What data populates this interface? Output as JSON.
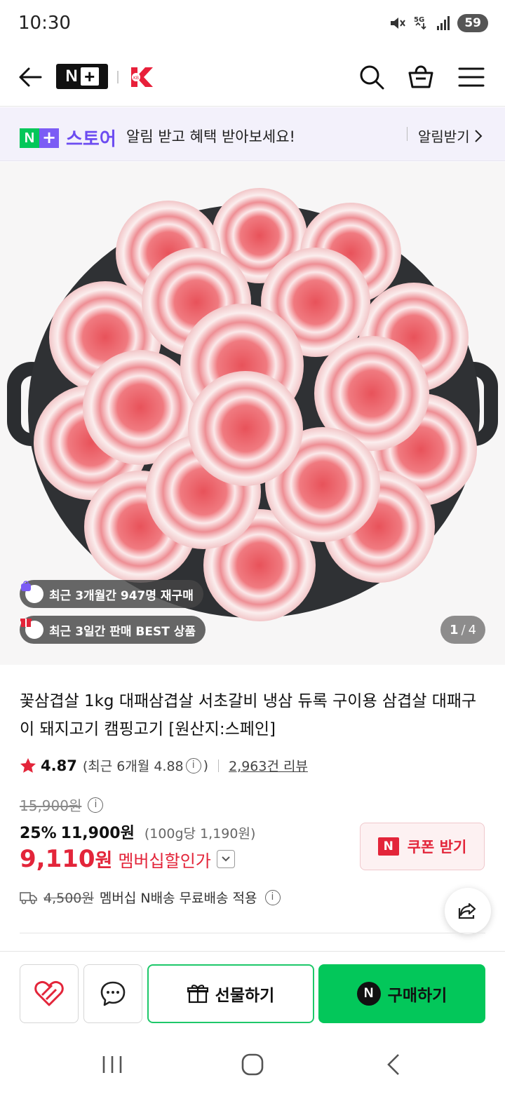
{
  "status_bar": {
    "time": "10:30",
    "battery": "59",
    "network": "5G"
  },
  "header": {
    "back_icon": "arrow-left-icon",
    "logo_text": "N",
    "logo_plus": "+",
    "icons": [
      "search-icon",
      "cart-icon",
      "menu-icon"
    ]
  },
  "banner": {
    "logo_n": "N",
    "logo_plus": "+",
    "store_word": "스토어",
    "message": "알림 받고 혜택 받아보세요!",
    "link_label": "알림받기"
  },
  "product_image": {
    "badges": [
      {
        "icon": "bag-icon",
        "text": "최근 3개월간 947명 재구매"
      },
      {
        "icon": "gift-icon",
        "text": "최근 3일간 판매 BEST 상품"
      }
    ],
    "page_current": "1",
    "page_sep": "/",
    "page_total": "4"
  },
  "product": {
    "title": "꽃삼겹살 1kg 대패삼겹살 서초갈비 냉삼 듀록 구이용 삼겹살 대패구이 돼지고기 캠핑고기 [원산지:스페인]",
    "rating": "4.87",
    "rating_recent_prefix": "(최근 6개월 4.88",
    "rating_recent_suffix": ")",
    "review_count": "2,963건 리뷰",
    "original_price": "15,900원",
    "discount": "25%",
    "sale_price": "11,900원",
    "unit_price": "(100g당 1,190원)",
    "member_price": "9,110",
    "member_won": "원",
    "member_label": "멤버십할인가",
    "coupon_label": "쿠폰 받기",
    "coupon_n": "N",
    "delivery_original": "4,500원",
    "delivery_text": "멤버십 N배송 무료배송 적용",
    "info_glyph": "i"
  },
  "bottom_bar": {
    "gift_label": "선물하기",
    "buy_label": "구매하기",
    "buy_n": "N"
  },
  "colors": {
    "naver_green": "#03c75a",
    "store_purple": "#6c4cf1",
    "sale_red": "#e3253a",
    "banner_bg": "#f3f1fb"
  }
}
